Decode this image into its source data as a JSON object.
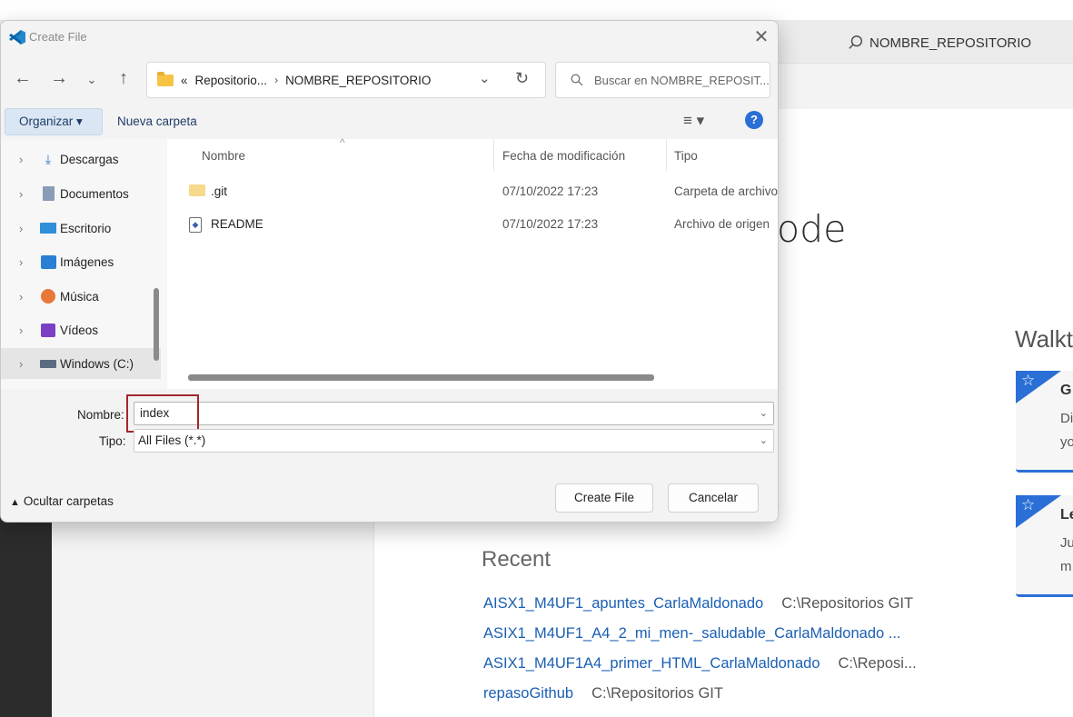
{
  "vscode": {
    "search_text": "NOMBRE_REPOSITORIO",
    "welcome_title_partial": "ode",
    "walkthroughs_partial": "Walkt",
    "cards": [
      {
        "title": "G",
        "line1": "Di",
        "line2": "yo"
      },
      {
        "title": "Le",
        "line1": "Ju",
        "line2": "m"
      }
    ],
    "recent_title": "Recent",
    "recent": [
      {
        "name": "AISX1_M4UF1_apuntes_CarlaMaldonado",
        "path": "C:\\Repositorios GIT"
      },
      {
        "name": "ASIX1_M4UF1_A4_2_mi_men-_saludable_CarlaMaldonado ...",
        "path": ""
      },
      {
        "name": "ASIX1_M4UF1A4_primer_HTML_CarlaMaldonado",
        "path": "C:\\Reposi..."
      },
      {
        "name": "repasoGithub",
        "path": "C:\\Repositorios GIT"
      }
    ]
  },
  "dialog": {
    "title": "Create File",
    "address": {
      "prefix": "«",
      "segments": [
        "Repositorio...",
        "NOMBRE_REPOSITORIO"
      ],
      "separator": "›"
    },
    "search_placeholder": "Buscar en NOMBRE_REPOSIT...",
    "toolbar": {
      "organize": "Organizar ▾",
      "new_folder": "Nueva carpeta"
    },
    "nav_items": [
      {
        "label": "Descargas",
        "icon": "download-icon"
      },
      {
        "label": "Documentos",
        "icon": "documents-icon"
      },
      {
        "label": "Escritorio",
        "icon": "desktop-icon"
      },
      {
        "label": "Imágenes",
        "icon": "pictures-icon"
      },
      {
        "label": "Música",
        "icon": "music-icon"
      },
      {
        "label": "Vídeos",
        "icon": "videos-icon"
      },
      {
        "label": "Windows (C:)",
        "icon": "drive-icon"
      }
    ],
    "columns": [
      "Nombre",
      "Fecha de modificación",
      "Tipo"
    ],
    "files": [
      {
        "name": ".git",
        "date": "07/10/2022 17:23",
        "type": "Carpeta de archivo"
      },
      {
        "name": "README",
        "date": "07/10/2022 17:23",
        "type": "Archivo de origen"
      }
    ],
    "filename_label": "Nombre:",
    "filename_value": "index",
    "type_label": "Tipo:",
    "type_value": "All Files (*.*)",
    "hide_folders": "Ocultar carpetas",
    "create_button": "Create File",
    "cancel_button": "Cancelar"
  }
}
